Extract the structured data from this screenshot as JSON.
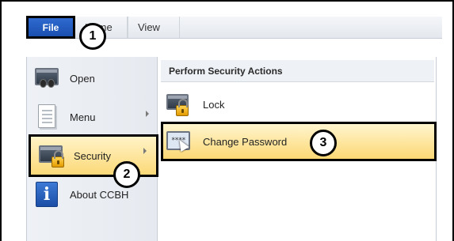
{
  "ribbon": {
    "file_label": "File",
    "tabs": [
      {
        "label": "Home"
      },
      {
        "label": "View"
      }
    ]
  },
  "left_menu": {
    "items": [
      {
        "label": "Open",
        "icon": "open-screen-icon"
      },
      {
        "label": "Menu",
        "icon": "document-icon"
      },
      {
        "label": "Security",
        "icon": "security-lock-icon",
        "selected": true
      },
      {
        "label": "About CCBH",
        "icon": "info-icon"
      }
    ]
  },
  "right_panel": {
    "title": "Perform Security Actions",
    "items": [
      {
        "label": "Lock",
        "icon": "lock-icon"
      },
      {
        "label": "Change Password",
        "icon": "change-password-icon",
        "selected": true
      }
    ]
  },
  "callouts": [
    "1",
    "2",
    "3"
  ],
  "colors": {
    "file_tab": "#1a4fae",
    "highlight": "#fcd978"
  }
}
